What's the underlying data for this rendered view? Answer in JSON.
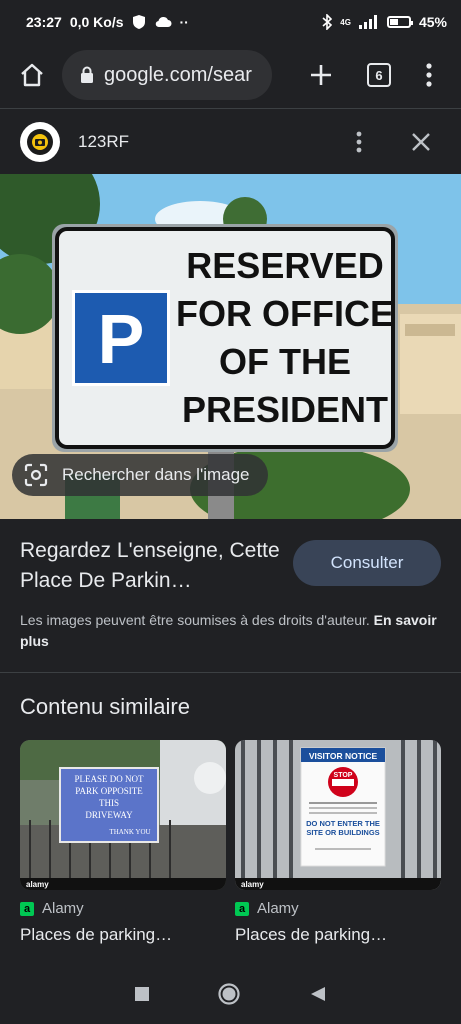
{
  "status": {
    "time": "23:27",
    "speed": "0,0 Ko/s",
    "network": "4G",
    "battery": "45%",
    "battery_level": 0.45
  },
  "browser": {
    "url": "google.com/sear",
    "tab_count": "6"
  },
  "sheet": {
    "source": "123RF"
  },
  "image": {
    "sign_lines": [
      "RESERVED",
      "FOR OFFICE",
      "OF THE",
      "PRESIDENT"
    ],
    "parking_letter": "P",
    "lens_label": "Rechercher dans l'image"
  },
  "result": {
    "title": "Regardez L'enseigne, Cette Place De Parkin…",
    "consult_label": "Consulter",
    "copyright_text": "Les images peuvent être soumises à des droits d'auteur.",
    "learn_more": "En savoir plus"
  },
  "similar": {
    "heading": "Contenu similaire",
    "items": [
      {
        "source": "Alamy",
        "title": "Places de parking…",
        "sign_lines": [
          "PLEASE DO NOT",
          "PARK OPPOSITE",
          "THIS",
          "DRIVEWAY",
          "THANK YOU"
        ],
        "watermark": "alamy"
      },
      {
        "source": "Alamy",
        "title": "Places de parking…",
        "sign_header": "VISITOR NOTICE",
        "stop": "STOP",
        "sign_lines": [
          "DO NOT ENTER THE",
          "SITE OR BUILDINGS"
        ],
        "watermark": "alamy"
      }
    ]
  },
  "icons": [
    "home-icon",
    "lock-icon",
    "plus-icon",
    "tabs-icon",
    "more-vert-icon",
    "close-icon",
    "lens-icon",
    "square-nav-icon",
    "circle-nav-icon",
    "back-triangle-icon"
  ]
}
